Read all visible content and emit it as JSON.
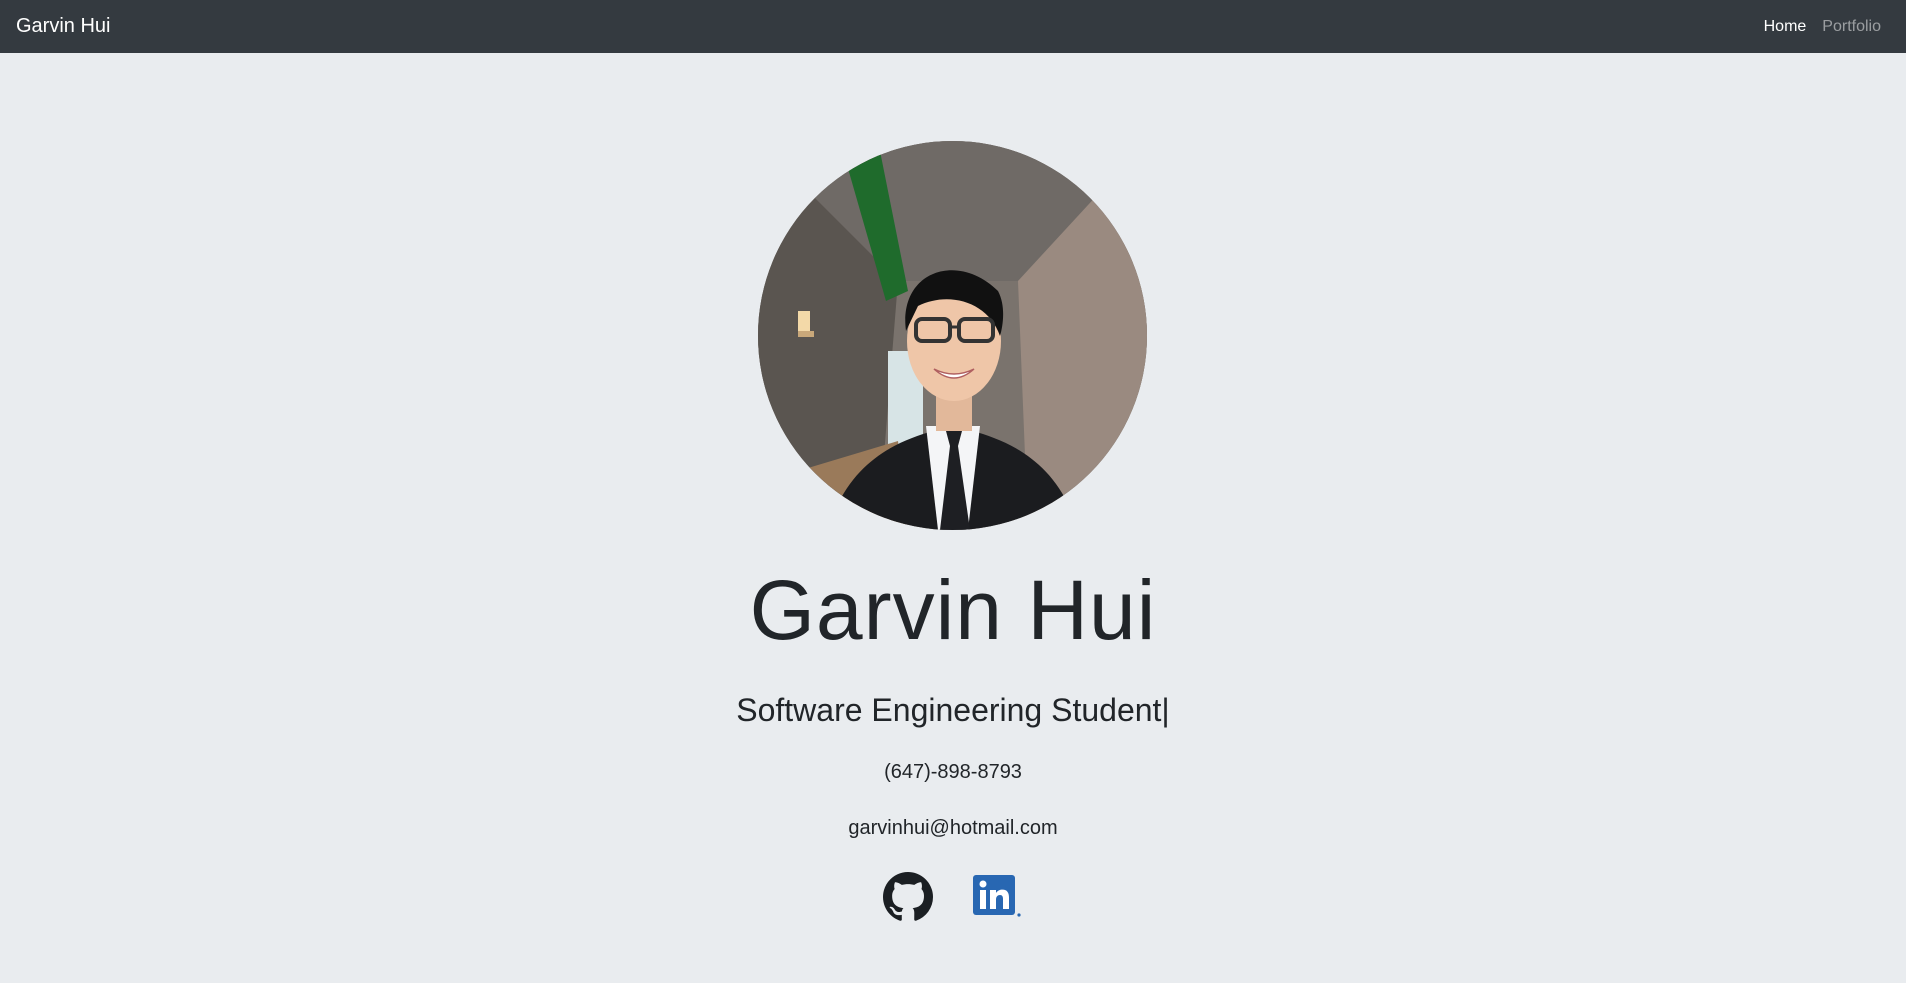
{
  "navbar": {
    "brand": "Garvin Hui",
    "links": [
      {
        "label": "Home",
        "active": true
      },
      {
        "label": "Portfolio",
        "active": false
      }
    ]
  },
  "profile": {
    "photo_icon": "profile-photo",
    "name": "Garvin Hui",
    "role": "Software Engineering Student",
    "cursor": "|",
    "phone": "(647)-898-8793",
    "email": "garvinhui@hotmail.com"
  },
  "socials": [
    {
      "icon": "github-icon"
    },
    {
      "icon": "linkedin-icon"
    }
  ],
  "colors": {
    "background": "#e9ecef",
    "navbar": "#343a40",
    "text": "#212529",
    "linkedin_blue": "#2867b2"
  }
}
